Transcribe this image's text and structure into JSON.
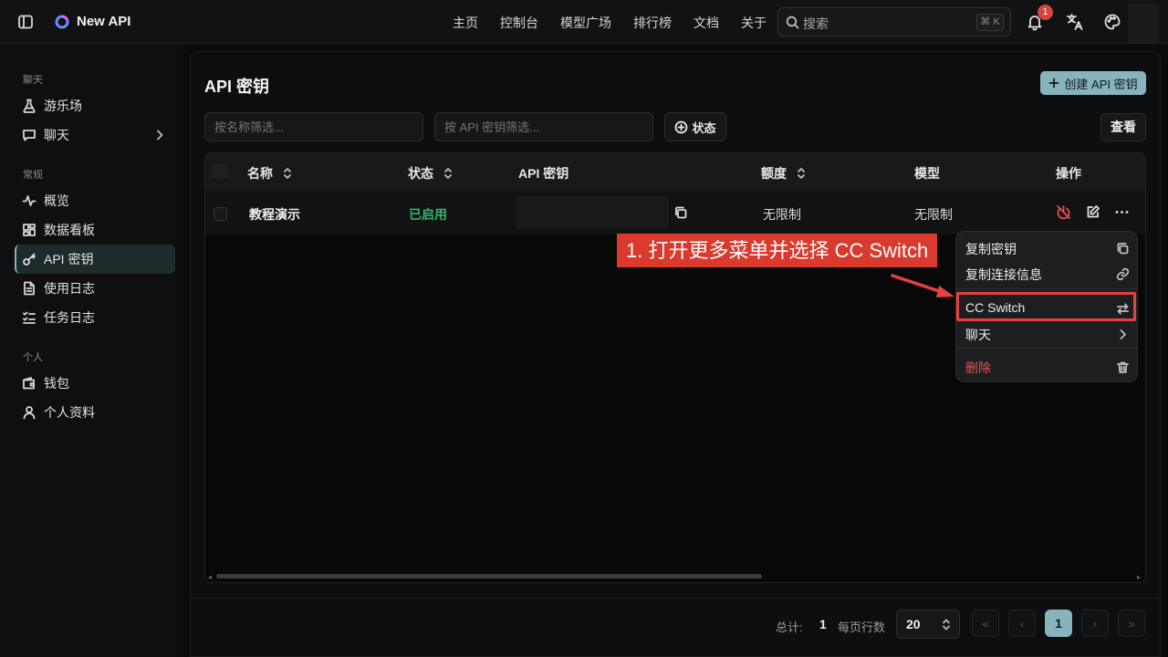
{
  "app": {
    "name": "New API"
  },
  "nav": [
    "主页",
    "控制台",
    "模型广场",
    "排行榜",
    "文档",
    "关于"
  ],
  "search": {
    "placeholder": "搜索",
    "shortcut": "⌘ K"
  },
  "notifications": {
    "count": "1"
  },
  "sidebar": {
    "section_chat": "聊天",
    "playground": "游乐场",
    "chat": "聊天",
    "section_general": "常规",
    "overview": "概览",
    "dashboard": "数据看板",
    "api_keys": "API 密钥",
    "usage_logs": "使用日志",
    "task_logs": "任务日志",
    "section_personal": "个人",
    "wallet": "钱包",
    "profile": "个人资料"
  },
  "page": {
    "title": "API 密钥",
    "create_button": "创建 API 密钥",
    "filter_name_placeholder": "按名称筛选...",
    "filter_key_placeholder": "按 API 密钥筛选...",
    "status_filter": "状态",
    "view_button": "查看"
  },
  "table": {
    "headers": {
      "name": "名称",
      "status": "状态",
      "key": "API 密钥",
      "quota": "额度",
      "model": "模型",
      "actions": "操作"
    },
    "rows": [
      {
        "name": "教程演示",
        "status": "已启用",
        "key": "",
        "quota": "无限制",
        "model": "无限制"
      }
    ]
  },
  "menu": {
    "copy_key": "复制密钥",
    "copy_conn": "复制连接信息",
    "cc_switch": "CC Switch",
    "chat": "聊天",
    "delete": "删除"
  },
  "annotation": {
    "text": "1. 打开更多菜单并选择 CC Switch"
  },
  "pagination": {
    "total_label": "总计:",
    "total": "1",
    "per_page_label": "每页行数",
    "per_page": "20",
    "current_page": "1"
  },
  "colors": {
    "accent": "#86b3bc",
    "success": "#38b26b",
    "danger": "#e05555",
    "annotation": "#da3a2d"
  }
}
